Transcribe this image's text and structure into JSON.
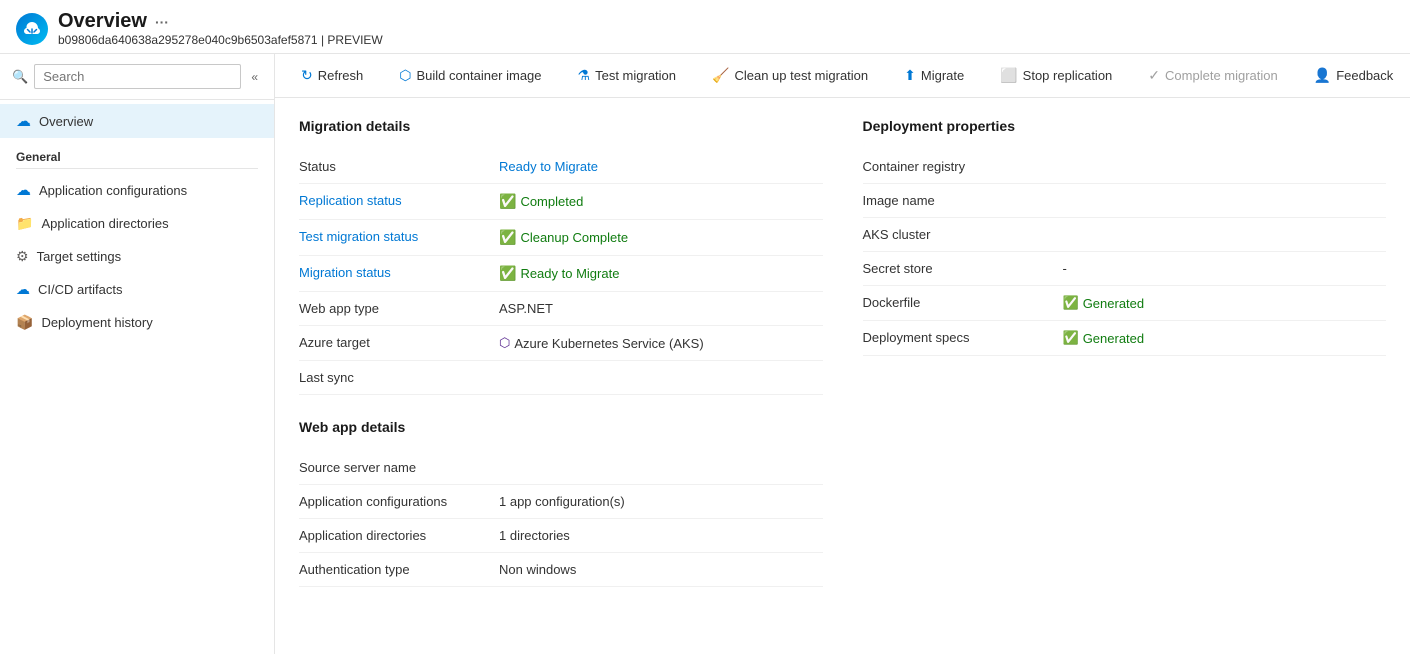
{
  "header": {
    "title": "Overview",
    "more_label": "···",
    "subtitle_id": "b09806da640638a295278e040c9b6503afef5871",
    "subtitle_tag": "PREVIEW"
  },
  "sidebar": {
    "search_placeholder": "Search",
    "collapse_icon": "«",
    "active_item": "Overview",
    "nav_items": [
      {
        "label": "Overview",
        "icon": "cloud"
      }
    ],
    "general_label": "General",
    "general_items": [
      {
        "label": "Application configurations",
        "icon": "cloud"
      },
      {
        "label": "Application directories",
        "icon": "folder"
      },
      {
        "label": "Target settings",
        "icon": "gear"
      },
      {
        "label": "CI/CD artifacts",
        "icon": "cicd"
      },
      {
        "label": "Deployment history",
        "icon": "history"
      }
    ]
  },
  "toolbar": {
    "refresh_label": "Refresh",
    "build_label": "Build container image",
    "test_label": "Test migration",
    "cleanup_label": "Clean up test migration",
    "migrate_label": "Migrate",
    "stop_label": "Stop replication",
    "complete_label": "Complete migration",
    "feedback_label": "Feedback"
  },
  "migration_details": {
    "section_title": "Migration details",
    "rows": [
      {
        "label": "Status",
        "value": "Ready to Migrate",
        "type": "link-green"
      },
      {
        "label": "Replication status",
        "value": "Completed",
        "type": "badge-green"
      },
      {
        "label": "Test migration status",
        "value": "Cleanup Complete",
        "type": "badge-green"
      },
      {
        "label": "Migration status",
        "value": "Ready to Migrate",
        "type": "badge-green"
      },
      {
        "label": "Web app type",
        "value": "ASP.NET",
        "type": "text"
      },
      {
        "label": "Azure target",
        "value": "Azure Kubernetes Service (AKS)",
        "type": "aks"
      },
      {
        "label": "Last sync",
        "value": "",
        "type": "text"
      }
    ]
  },
  "web_app_details": {
    "section_title": "Web app details",
    "rows": [
      {
        "label": "Source server name",
        "value": "",
        "type": "text"
      },
      {
        "label": "Application configurations",
        "value": "1 app configuration(s)",
        "type": "text"
      },
      {
        "label": "Application directories",
        "value": "1 directories",
        "type": "text"
      },
      {
        "label": "Authentication type",
        "value": "Non windows",
        "type": "text"
      }
    ]
  },
  "deployment_properties": {
    "section_title": "Deployment properties",
    "rows": [
      {
        "label": "Container registry",
        "value": "",
        "type": "text"
      },
      {
        "label": "Image name",
        "value": "",
        "type": "text"
      },
      {
        "label": "AKS cluster",
        "value": "",
        "type": "text"
      },
      {
        "label": "Secret store",
        "value": "-",
        "type": "text"
      },
      {
        "label": "Dockerfile",
        "value": "Generated",
        "type": "badge-green"
      },
      {
        "label": "Deployment specs",
        "value": "Generated",
        "type": "badge-green"
      }
    ]
  }
}
